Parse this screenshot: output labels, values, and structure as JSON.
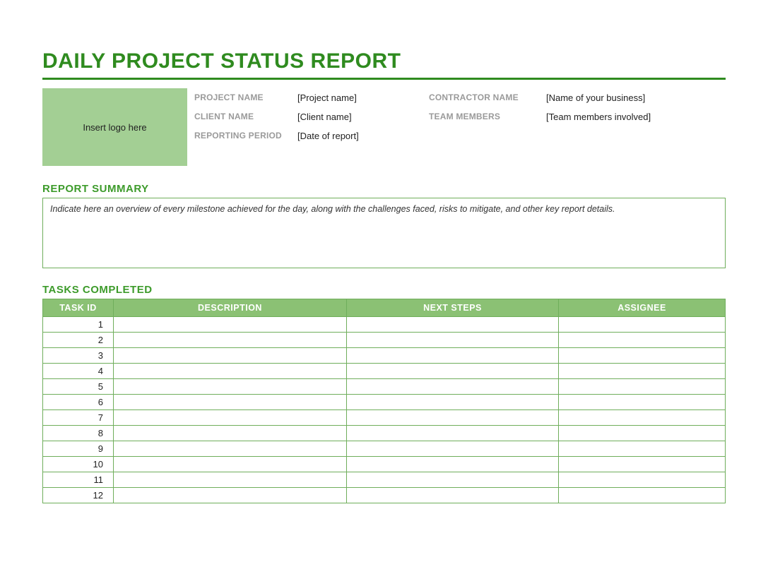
{
  "title": "DAILY PROJECT STATUS REPORT",
  "logo_placeholder": "Insert logo here",
  "info": {
    "project_name_label": "PROJECT NAME",
    "project_name_value": "[Project name]",
    "contractor_name_label": "CONTRACTOR NAME",
    "contractor_name_value": "[Name of your business]",
    "client_name_label": "CLIENT NAME",
    "client_name_value": "[Client name]",
    "team_members_label": "TEAM MEMBERS",
    "team_members_value": "[Team members involved]",
    "reporting_period_label": "REPORTING PERIOD",
    "reporting_period_value": "[Date of report]"
  },
  "sections": {
    "summary_head": "REPORT SUMMARY",
    "summary_text": "Indicate here an overview of every milestone achieved for the day, along with the challenges faced, risks to mitigate, and other key report details.",
    "tasks_head": "TASKS COMPLETED"
  },
  "tasks_columns": {
    "id": "TASK ID",
    "description": "DESCRIPTION",
    "next_steps": "NEXT STEPS",
    "assignee": "ASSIGNEE"
  },
  "tasks": [
    {
      "id": "1",
      "description": "",
      "next_steps": "",
      "assignee": ""
    },
    {
      "id": "2",
      "description": "",
      "next_steps": "",
      "assignee": ""
    },
    {
      "id": "3",
      "description": "",
      "next_steps": "",
      "assignee": ""
    },
    {
      "id": "4",
      "description": "",
      "next_steps": "",
      "assignee": ""
    },
    {
      "id": "5",
      "description": "",
      "next_steps": "",
      "assignee": ""
    },
    {
      "id": "6",
      "description": "",
      "next_steps": "",
      "assignee": ""
    },
    {
      "id": "7",
      "description": "",
      "next_steps": "",
      "assignee": ""
    },
    {
      "id": "8",
      "description": "",
      "next_steps": "",
      "assignee": ""
    },
    {
      "id": "9",
      "description": "",
      "next_steps": "",
      "assignee": ""
    },
    {
      "id": "10",
      "description": "",
      "next_steps": "",
      "assignee": ""
    },
    {
      "id": "11",
      "description": "",
      "next_steps": "",
      "assignee": ""
    },
    {
      "id": "12",
      "description": "",
      "next_steps": "",
      "assignee": ""
    }
  ]
}
